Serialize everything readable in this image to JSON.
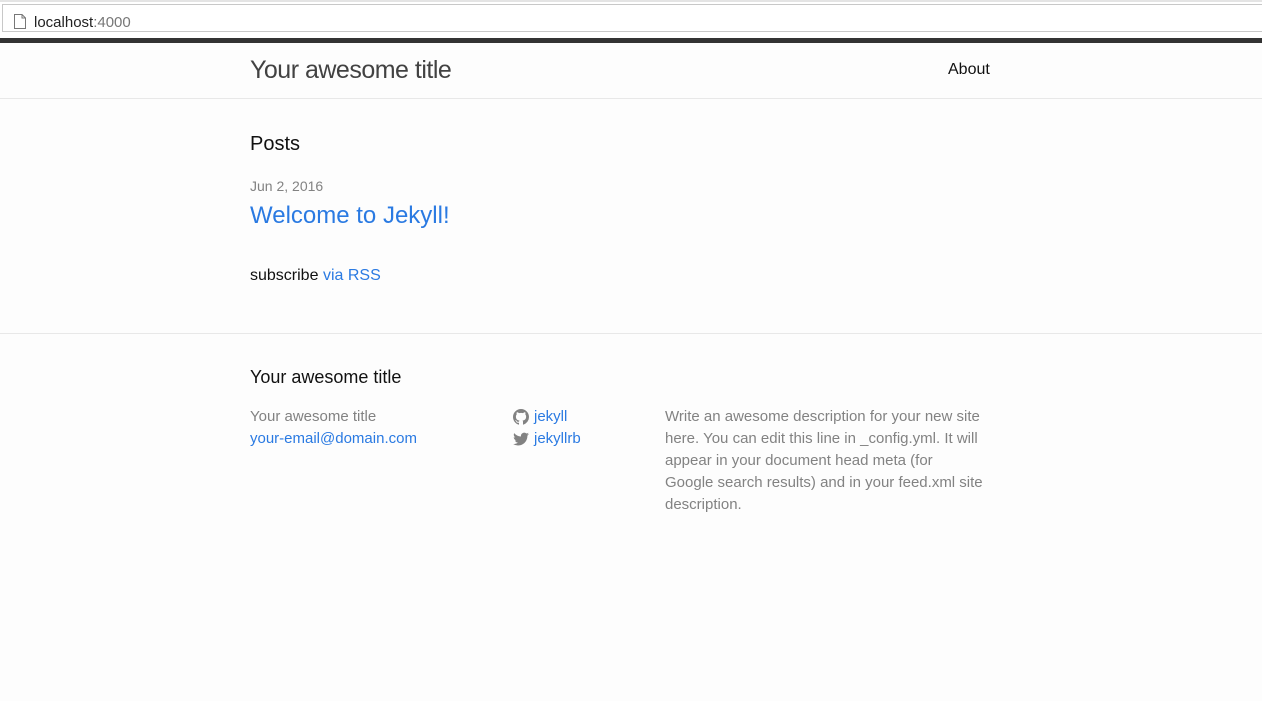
{
  "browser": {
    "url_host": "localhost",
    "url_port": ":4000"
  },
  "header": {
    "site_title": "Your awesome title",
    "nav": [
      {
        "label": "About"
      }
    ]
  },
  "main": {
    "posts_heading": "Posts",
    "posts": [
      {
        "date": "Jun 2, 2016",
        "title": "Welcome to Jekyll!"
      }
    ],
    "rss_prefix": "subscribe",
    "rss_link": "via RSS"
  },
  "footer": {
    "heading": "Your awesome title",
    "site_name": "Your awesome title",
    "email": "your-email@domain.com",
    "social": [
      {
        "icon": "github-icon",
        "label": "jekyll"
      },
      {
        "icon": "twitter-icon",
        "label": "jekyllrb"
      }
    ],
    "description": "Write an awesome description for your new site here. You can edit this line in _config.yml. It will appear in your document head meta (for Google search results) and in your feed.xml site description."
  },
  "colors": {
    "link": "#2a7ae2",
    "muted": "#828282",
    "text": "#111111",
    "header_band": "#333333"
  }
}
